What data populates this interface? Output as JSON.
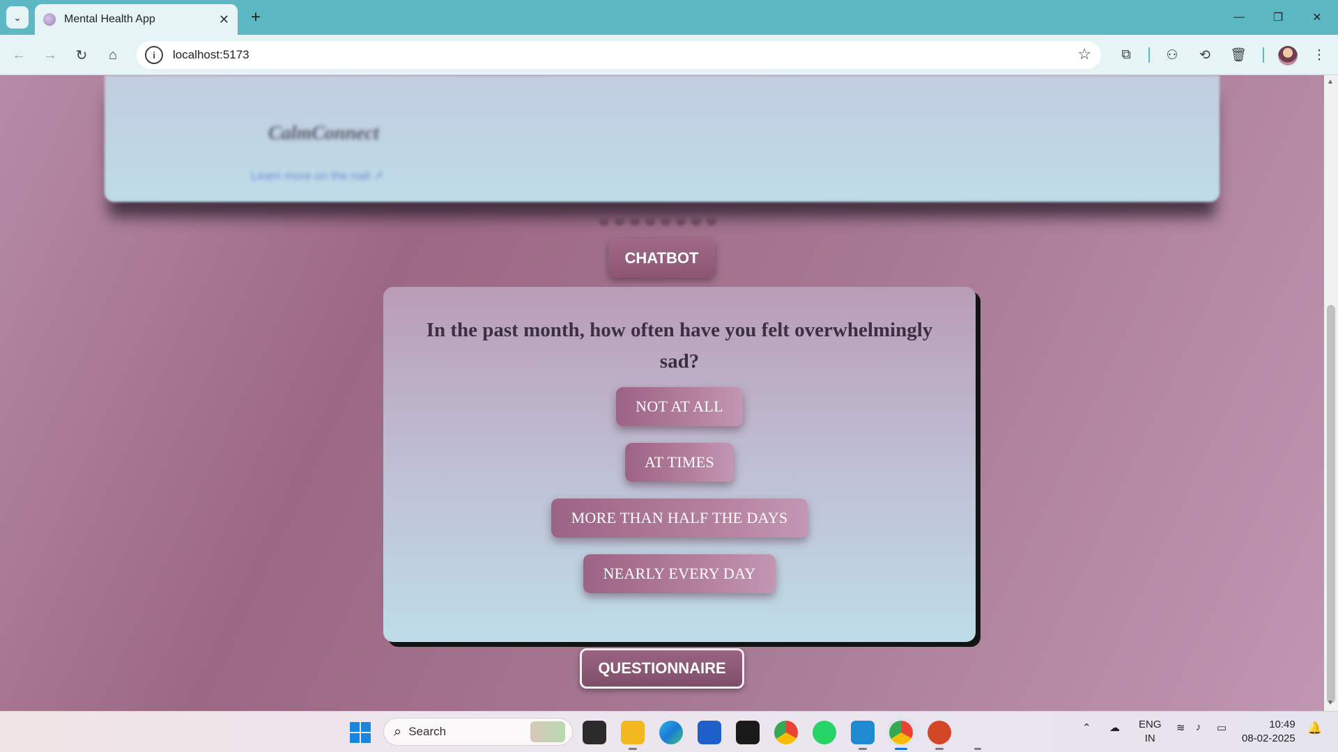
{
  "browser": {
    "tab_title": "Mental Health App",
    "url": "localhost:5173",
    "new_tab_label": "+",
    "close_tab_label": "✕"
  },
  "page": {
    "brand": "CalmConnect",
    "learn_more": "Learn more on the nalt",
    "chatbot_label": "CHATBOT",
    "question": "In the past month, how often have you felt overwhelmingly sad?",
    "options": [
      "NOT AT ALL",
      "AT TIMES",
      "MORE THAN HALF THE DAYS",
      "NEARLY EVERY DAY"
    ],
    "questionnaire_label": "QUESTIONNAIRE",
    "carousel_dot_count": 8
  },
  "taskbar": {
    "search_label": "Search",
    "language": "ENG",
    "region": "IN",
    "time": "10:49",
    "date": "08-02-2025"
  },
  "colors": {
    "tabbar": "#5cb8c2",
    "toolbar": "#e6f4f5",
    "button_mauve": "#9c6484",
    "card_shadow": "#141414"
  },
  "icons": [
    "tab-search-icon",
    "favicon-icon",
    "back-icon",
    "forward-icon",
    "reload-icon",
    "home-icon",
    "site-info-icon",
    "bookmark-star-icon",
    "extensions-icon",
    "incognito-icon",
    "history-icon",
    "delete-icon",
    "profile-avatar",
    "more-menu-icon",
    "windows-start-icon",
    "search-icon",
    "file-explorer-icon",
    "edge-icon",
    "store-icon",
    "terminal-icon",
    "chrome-icon",
    "whatsapp-icon",
    "vscode-icon",
    "powerpoint-icon",
    "wifi-icon",
    "volume-icon",
    "battery-icon",
    "cloud-icon"
  ]
}
